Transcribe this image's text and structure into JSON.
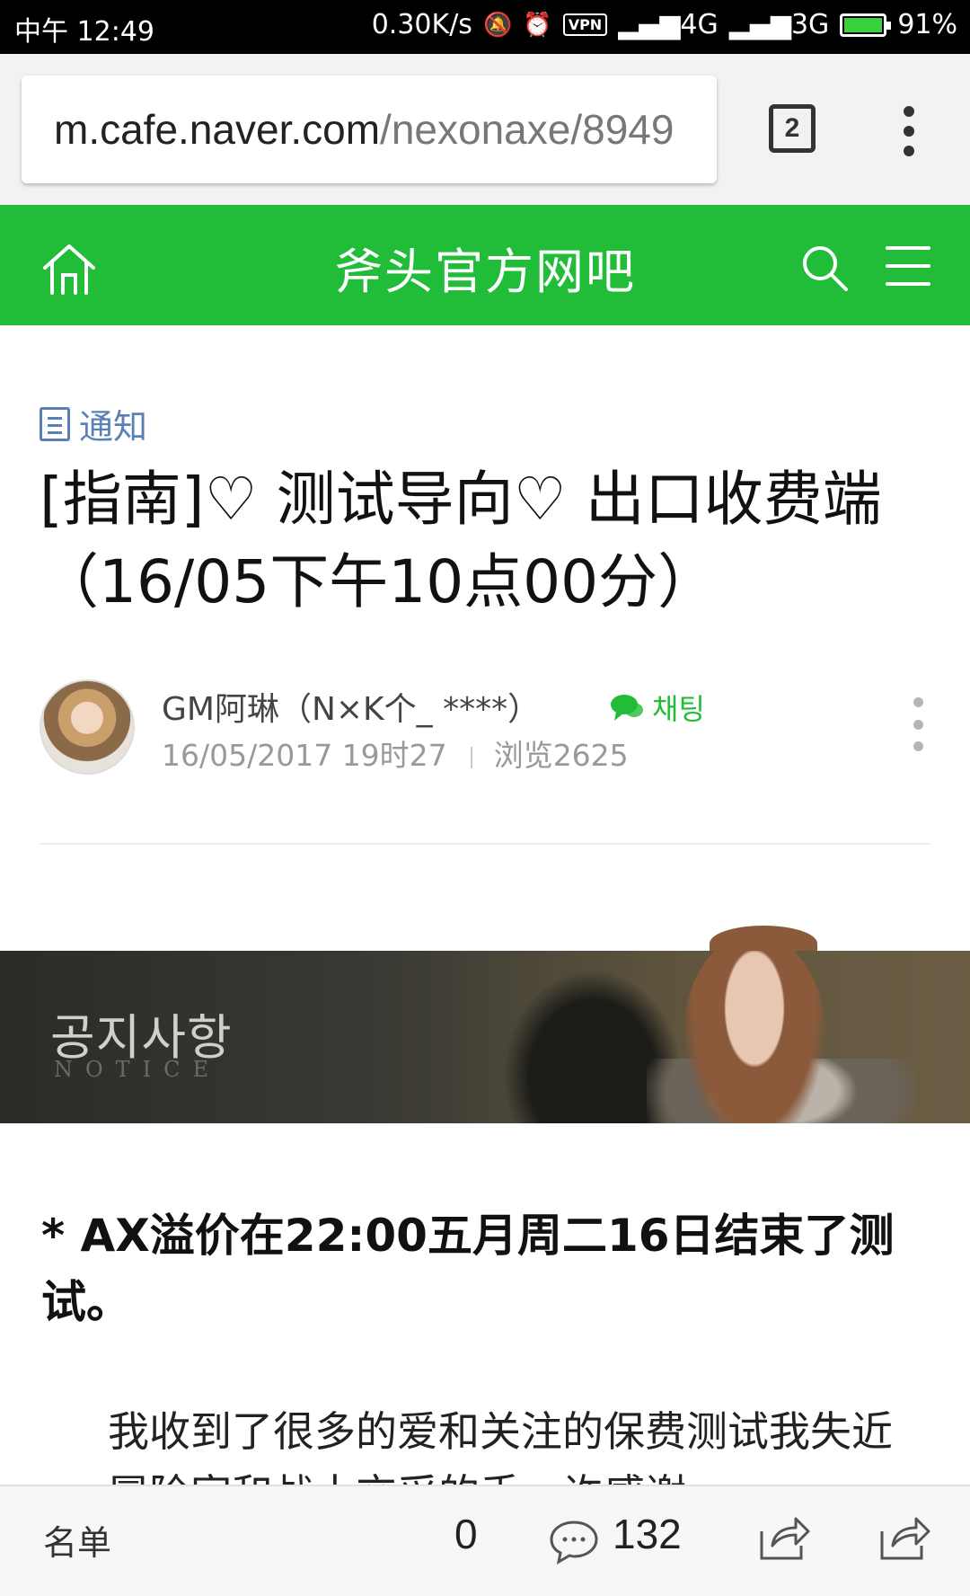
{
  "status_bar": {
    "time": "中午 12:49",
    "speed": "0.30K/s",
    "vpn": "VPN",
    "net1": "4G",
    "net2": "3G",
    "battery": "91%"
  },
  "browser": {
    "url_host": "m.cafe.naver.com",
    "url_path": "/nexonaxe/8949",
    "tab_count": "2"
  },
  "cafe": {
    "title": "斧头官方网吧"
  },
  "article": {
    "category": "通知",
    "title": "[指南]♡ 测试导向♡ 出口收费端（16/05下午10点00分）",
    "author": "GM阿琳（N×K个_ ****）",
    "chat_label": "채팅",
    "date": "16/05/2017 19时27",
    "views": "浏览2625",
    "banner_title": "공지사항",
    "banner_sub": "NOTICE",
    "bold_line": "* AX溢价在22:00五月周二16日结束了测试。",
    "body": "我收到了很多的爱和关注的保费测试我失近冒险家和战士交采的手，许感谢"
  },
  "bottom_bar": {
    "list_label": "名单",
    "likes": "0",
    "comments": "132"
  },
  "colors": {
    "brand_green": "#21bd38",
    "category_blue": "#5a80b8"
  }
}
